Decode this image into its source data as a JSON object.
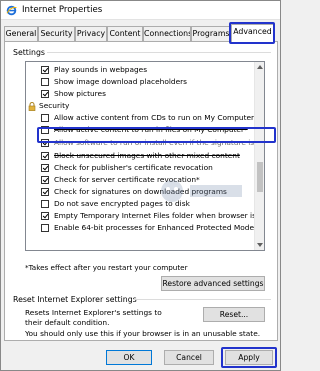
{
  "window": {
    "title": "Internet Properties"
  },
  "tabs": [
    {
      "label": "General",
      "active": false
    },
    {
      "label": "Security",
      "active": false
    },
    {
      "label": "Privacy",
      "active": false
    },
    {
      "label": "Content",
      "active": false
    },
    {
      "label": "Connections",
      "active": false
    },
    {
      "label": "Programs",
      "active": false
    },
    {
      "label": "Advanced",
      "active": true
    }
  ],
  "settings": {
    "group_label": "Settings",
    "items": [
      {
        "label": "Play sounds in webpages",
        "checked": true,
        "kind": "checkbox"
      },
      {
        "label": "Show image download placeholders",
        "checked": false,
        "kind": "checkbox"
      },
      {
        "label": "Show pictures",
        "checked": true,
        "kind": "checkbox"
      },
      {
        "label": "Security",
        "kind": "category"
      },
      {
        "label": "Allow active content from CDs to run on My Computer*",
        "checked": false,
        "kind": "checkbox"
      },
      {
        "label": "Allow active content to run in files on My Computer*",
        "checked": false,
        "kind": "checkbox"
      },
      {
        "label": "Allow software to run or install even if the signature is invalid",
        "checked": true,
        "kind": "checkbox",
        "highlighted": true
      },
      {
        "label": "Block unsecured images with other mixed content",
        "checked": true,
        "kind": "checkbox"
      },
      {
        "label": "Check for publisher's certificate revocation",
        "checked": true,
        "kind": "checkbox"
      },
      {
        "label": "Check for server certificate revocation*",
        "checked": true,
        "kind": "checkbox"
      },
      {
        "label": "Check for signatures on downloaded programs",
        "checked": true,
        "kind": "checkbox"
      },
      {
        "label": "Do not save encrypted pages to disk",
        "checked": false,
        "kind": "checkbox"
      },
      {
        "label": "Empty Temporary Internet Files folder when browser is clo",
        "checked": true,
        "kind": "checkbox"
      },
      {
        "label": "Enable 64-bit processes for Enhanced Protected Mode*",
        "checked": false,
        "kind": "checkbox"
      }
    ],
    "restart_note": "*Takes effect after you restart your computer",
    "restore_button": "Restore advanced settings"
  },
  "reset": {
    "group_label": "Reset Internet Explorer settings",
    "description": "Resets Internet Explorer's settings to their default condition.",
    "button": "Reset...",
    "warning": "You should only use this if your browser is in an unusable state."
  },
  "footer": {
    "ok": "OK",
    "cancel": "Cancel",
    "apply": "Apply"
  },
  "colors": {
    "highlight": "#2233cc",
    "accent": "#0078d7"
  }
}
